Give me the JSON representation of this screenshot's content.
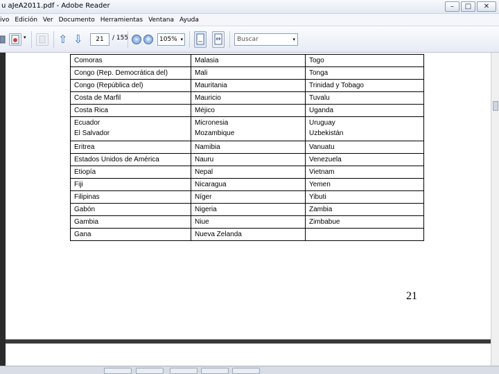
{
  "window": {
    "title": "u aJeA2011.pdf - Adobe Reader",
    "controls": {
      "minimize": "–",
      "maximize": "□",
      "close": "✕"
    }
  },
  "menu": [
    "ivo",
    "Edición",
    "Ver",
    "Documento",
    "Herramientas",
    "Ventana",
    "Ayuda"
  ],
  "toolbar": {
    "current_page": "21",
    "total_pages": "/ 155",
    "zoom_out": "–",
    "zoom_in": "+",
    "zoom": "105%",
    "search_placeholder": "Buscar",
    "dropdown_glyph": "▾",
    "prev_glyph": "⇧",
    "next_glyph": "⇩"
  },
  "table": {
    "rows": [
      [
        "Comoras",
        "Malasia",
        "Togo"
      ],
      [
        "Congo (Rep. Democrática del)",
        "Mali",
        "Tonga"
      ],
      [
        "Congo (República del)",
        "Mauritania",
        "Trinidad y Tobago"
      ],
      [
        "Costa de Marfil",
        "Mauricio",
        "Tuvalu"
      ],
      [
        "Costa Rica",
        "Méjico",
        "Uganda"
      ],
      [
        "Ecuador\nEl Salvador",
        "Micronesia\nMozambique",
        "Uruguay\nUzbekistán"
      ],
      [
        "Eritrea",
        "Namibia",
        "Vanuatu"
      ],
      [
        "Estados Unidos de América",
        "Nauru",
        "Venezuela"
      ],
      [
        "Etiopía",
        "Nepal",
        "Vietnam"
      ],
      [
        "Fiji",
        "Nicaragua",
        "Yemen"
      ],
      [
        "Filipinas",
        "Níger",
        "Yibuti"
      ],
      [
        "Gabón",
        "Nigeria",
        "Zambia"
      ],
      [
        "Gambia",
        "Niue",
        "Zimbabue"
      ],
      [
        "Gana",
        "Nueva Zelanda",
        ""
      ]
    ]
  },
  "page_number": "21"
}
